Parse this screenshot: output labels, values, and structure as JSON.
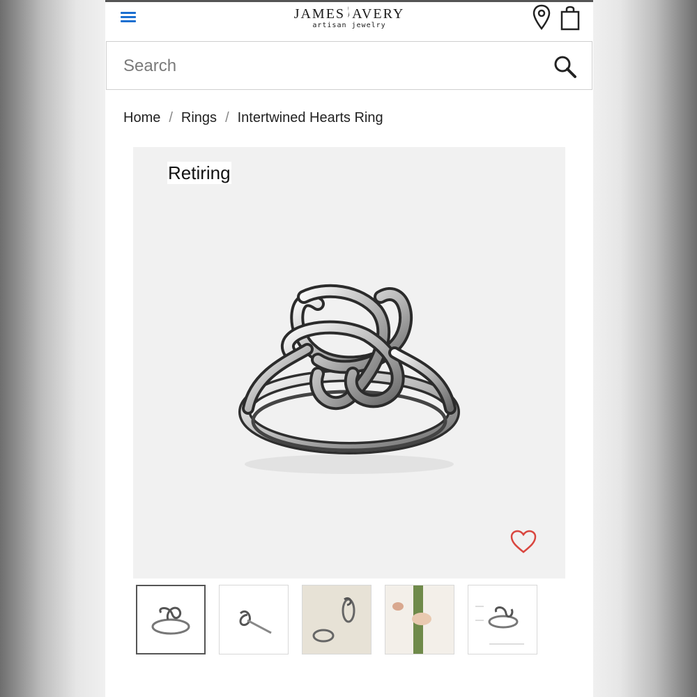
{
  "header": {
    "logo_main": "JAMES AVERY",
    "logo_left": "JAMES",
    "logo_right": "AVERY",
    "logo_sub": "artisan jewelry"
  },
  "search": {
    "placeholder": "Search"
  },
  "breadcrumb": {
    "items": [
      "Home",
      "Rings",
      "Intertwined Hearts Ring"
    ]
  },
  "product": {
    "badge": "Retiring"
  },
  "icons": {
    "menu": "hamburger-icon",
    "location": "map-pin-icon",
    "bag": "shopping-bag-icon",
    "search": "magnifier-icon",
    "favorite": "heart-icon"
  },
  "colors": {
    "menu_accent": "#1b6fd0",
    "heart": "#d9463f"
  },
  "thumbnails": {
    "count_shown": 5,
    "selected_index": 0
  }
}
